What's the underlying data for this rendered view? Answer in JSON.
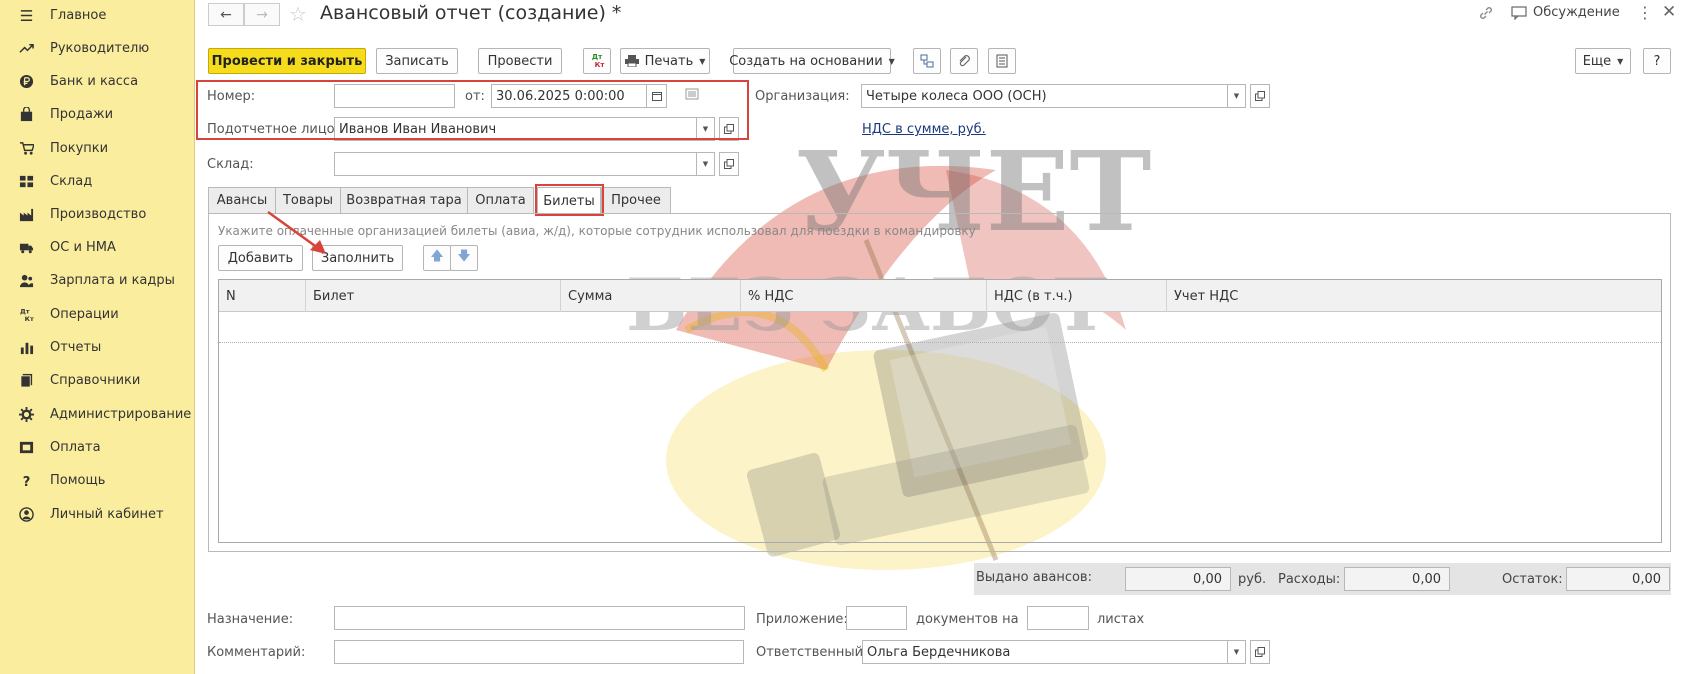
{
  "sidebar": {
    "items": [
      {
        "label": "Главное",
        "icon": "menu-icon"
      },
      {
        "label": "Руководителю",
        "icon": "trend-icon"
      },
      {
        "label": "Банк и касса",
        "icon": "ruble-icon"
      },
      {
        "label": "Продажи",
        "icon": "bag-icon"
      },
      {
        "label": "Покупки",
        "icon": "cart-icon"
      },
      {
        "label": "Склад",
        "icon": "warehouse-icon"
      },
      {
        "label": "Производство",
        "icon": "factory-icon"
      },
      {
        "label": "ОС и НМА",
        "icon": "truck-icon"
      },
      {
        "label": "Зарплата и кадры",
        "icon": "people-icon"
      },
      {
        "label": "Операции",
        "icon": "dt-kt-icon"
      },
      {
        "label": "Отчеты",
        "icon": "bar-chart-icon"
      },
      {
        "label": "Справочники",
        "icon": "books-icon"
      },
      {
        "label": "Администрирование",
        "icon": "gear-icon"
      },
      {
        "label": "Оплата",
        "icon": "payment-icon"
      },
      {
        "label": "Помощь",
        "icon": "question-icon"
      },
      {
        "label": "Личный кабинет",
        "icon": "user-circle-icon"
      }
    ]
  },
  "header": {
    "title": "Авансовый отчет (создание) *",
    "discussion": "Обсуждение"
  },
  "toolbar": {
    "post_close": "Провести и закрыть",
    "save": "Записать",
    "post": "Провести",
    "dtkt_top": "Дт",
    "dtkt_bottom": "Кт",
    "print": "Печать",
    "create_based": "Создать на основании",
    "more": "Еще",
    "help": "?"
  },
  "form": {
    "number_label": "Номер:",
    "number_value": "",
    "date_label": "от:",
    "date_value": "30.06.2025  0:00:00",
    "org_label": "Организация:",
    "org_value": "Четыре колеса ООО (ОСН)",
    "person_label": "Подотчетное лицо:",
    "person_value": "Иванов Иван Иванович",
    "vat_link": "НДС в сумме, руб.",
    "warehouse_label": "Склад:",
    "warehouse_value": ""
  },
  "tabs": [
    "Авансы",
    "Товары",
    "Возвратная тара",
    "Оплата",
    "Билеты",
    "Прочее"
  ],
  "active_tab": "Билеты",
  "tickets": {
    "hint": "Укажите оплаченные организацией билеты (авиа, ж/д), которые сотрудник использовал для поездки в командировку",
    "add": "Добавить",
    "fill": "Заполнить",
    "columns": [
      "N",
      "Билет",
      "Сумма",
      "% НДС",
      "НДС (в т.ч.)",
      "Учет НДС"
    ],
    "rows": []
  },
  "totals": {
    "issued_label": "Выдано авансов:",
    "issued_value": "0,00",
    "currency": "руб.",
    "expenses_label": "Расходы:",
    "expenses_value": "0,00",
    "balance_label": "Остаток:",
    "balance_value": "0,00"
  },
  "footer": {
    "purpose_label": "Назначение:",
    "purpose_value": "",
    "attach_label": "Приложение:",
    "attach_value": "",
    "docs_label": "документов на",
    "sheets_value": "",
    "sheets_label": "листах",
    "comment_label": "Комментарий:",
    "comment_value": "",
    "responsible_label": "Ответственный:",
    "responsible_value": "Ольга Бердечникова"
  },
  "watermark": {
    "line1": "УЧЕТ",
    "line2": "БЕЗ ЗАБОТ"
  },
  "colors": {
    "sidebar_bg": "#fbed9e",
    "primary_button": "#f5dd1c",
    "highlight_red": "#d6443b",
    "link": "#1a3a7c"
  }
}
